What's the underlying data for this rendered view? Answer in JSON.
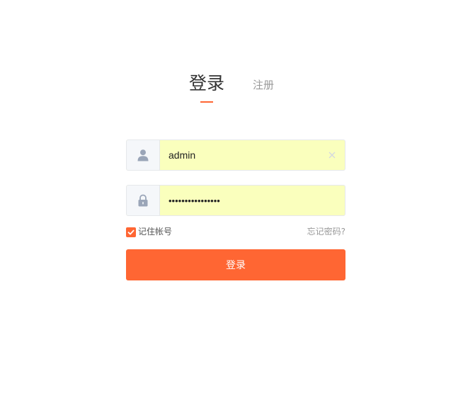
{
  "tabs": {
    "login_label": "登录",
    "register_label": "注册",
    "active": "login"
  },
  "username": {
    "icon": "user-icon",
    "value": "admin",
    "clear_icon": "close-icon"
  },
  "password": {
    "icon": "lock-icon",
    "value": "••••••••••••••••"
  },
  "remember": {
    "checked": true,
    "label": "记住帐号"
  },
  "forgot_label": "忘记密码?",
  "submit_label": "登录",
  "colors": {
    "accent": "#ff6633",
    "autofill_bg": "#faffbd",
    "icon_gray": "#9aa5b8"
  }
}
